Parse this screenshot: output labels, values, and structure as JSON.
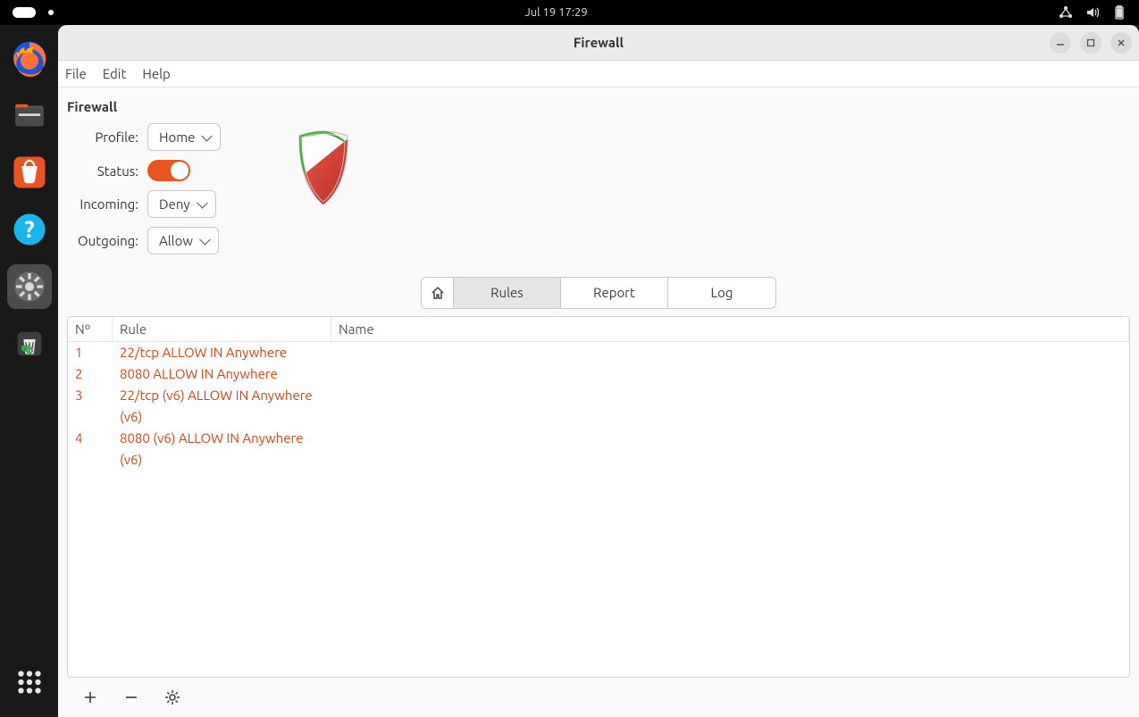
{
  "topbar": {
    "datetime": "Jul 19  17:29"
  },
  "dock": {
    "items": [
      "firefox",
      "files",
      "software",
      "help",
      "settings",
      "trash",
      "show-apps"
    ]
  },
  "window": {
    "title": "Firewall",
    "menus": {
      "file": "File",
      "edit": "Edit",
      "help": "Help"
    }
  },
  "app": {
    "heading": "Firewall",
    "labels": {
      "profile": "Profile:",
      "status": "Status:",
      "incoming": "Incoming:",
      "outgoing": "Outgoing:"
    },
    "profile_value": "Home",
    "status_on": true,
    "incoming_value": "Deny",
    "outgoing_value": "Allow"
  },
  "switcher": {
    "home_icon": "home",
    "rules": "Rules",
    "report": "Report",
    "log": "Log",
    "active": "rules"
  },
  "table": {
    "headers": {
      "n": "Nº",
      "rule": "Rule",
      "name": "Name"
    },
    "rows": [
      {
        "n": "1",
        "rule": "22/tcp ALLOW IN Anywhere",
        "name": ""
      },
      {
        "n": "2",
        "rule": "8080 ALLOW IN Anywhere",
        "name": ""
      },
      {
        "n": "3",
        "rule": "22/tcp (v6) ALLOW IN Anywhere (v6)",
        "name": ""
      },
      {
        "n": "4",
        "rule": "8080 (v6) ALLOW IN Anywhere (v6)",
        "name": ""
      }
    ]
  }
}
